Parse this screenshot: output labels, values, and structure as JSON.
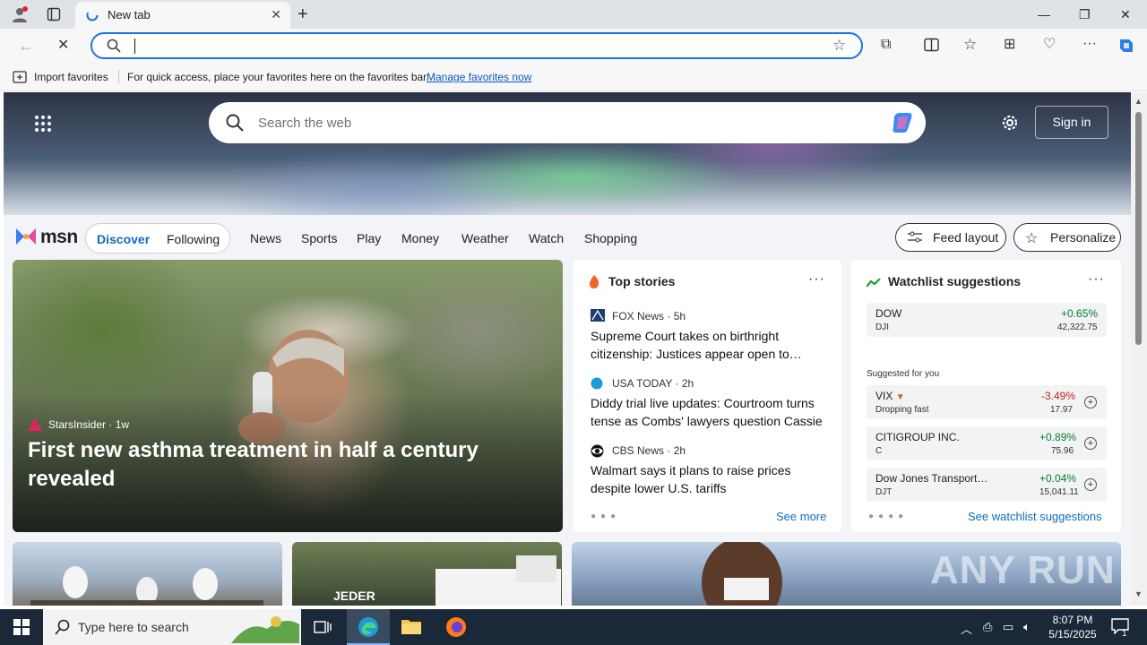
{
  "browser": {
    "tab": {
      "title": "New tab"
    },
    "address_bar": {
      "value": ""
    },
    "favorites_bar": {
      "import_label": "Import favorites",
      "hint": "For quick access, place your favorites here on the favorites bar.",
      "manage_link": "Manage favorites now"
    }
  },
  "msn": {
    "search_placeholder": "Search the web",
    "sign_in": "Sign in",
    "logo_text": "msn",
    "toggle": {
      "discover": "Discover",
      "following": "Following"
    },
    "nav": [
      "News",
      "Sports",
      "Play",
      "Money",
      "Weather",
      "Watch",
      "Shopping"
    ],
    "feed_layout": "Feed layout",
    "personalize": "Personalize",
    "hero": {
      "source": "StarsInsider",
      "age": "1w",
      "headline": "First new asthma treatment in half a century revealed"
    },
    "top_stories": {
      "title": "Top stories",
      "items": [
        {
          "source": "FOX News",
          "age": "5h",
          "title": "Supreme Court takes on birthright citizenship: Justices appear open to…"
        },
        {
          "source": "USA TODAY",
          "age": "2h",
          "title": "Diddy trial live updates: Courtroom turns tense as Combs' lawyers question Cassie"
        },
        {
          "source": "CBS News",
          "age": "2h",
          "title": "Walmart says it plans to raise prices despite lower U.S. tariffs"
        }
      ],
      "see_more": "See more"
    },
    "watchlist": {
      "title": "Watchlist suggestions",
      "main": {
        "name": "DOW",
        "symbol": "DJI",
        "change": "+0.65%",
        "value": "42,322.75"
      },
      "suggested_label": "Suggested for you",
      "suggestions": [
        {
          "name": "VIX",
          "symbol": "Dropping fast",
          "change": "-3.49%",
          "value": "17.97",
          "direction": "down"
        },
        {
          "name": "CITIGROUP INC.",
          "symbol": "C",
          "change": "+0.89%",
          "value": "75.96",
          "direction": "up"
        },
        {
          "name": "Dow Jones Transport…",
          "symbol": "DJT",
          "change": "+0.04%",
          "value": "15,041.11",
          "direction": "up"
        }
      ],
      "see_link": "See watchlist suggestions"
    },
    "bottom_card_text": "JEDER"
  },
  "watermark": "ANY RUN",
  "taskbar": {
    "search_placeholder": "Type here to search",
    "time": "8:07 PM",
    "date": "5/15/2025",
    "notification_count": "1"
  },
  "colors": {
    "accent": "#0f6cbd",
    "positive": "#0a7d2c",
    "negative": "#c4261d",
    "taskbar": "#1b2838"
  }
}
